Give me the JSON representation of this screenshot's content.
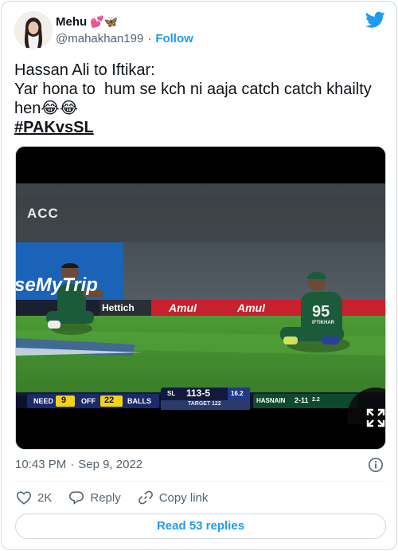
{
  "user": {
    "display_name": "Mehu",
    "name_emoji": "💕🦋",
    "handle": "@mahakhan199",
    "separator": "·",
    "follow_label": "Follow"
  },
  "tweet": {
    "text_lines": [
      "Hassan Ali to Iftikar:",
      "Yar hona to  hum se kch ni aaja catch catch khailty",
      "hen😂😂"
    ],
    "hashtag": "#PAKvsSL",
    "time": "10:43 PM",
    "date_separator": "·",
    "date": "Sep 9, 2022"
  },
  "media": {
    "broadcaster_logo": "ACC",
    "ad_boards": [
      "Amul",
      "Amul",
      "Hettich",
      "seMyTrip"
    ],
    "player_shirt": "95",
    "player_name": "IFTIKHAR",
    "scorebar": {
      "need_label": "NEED",
      "need_value": "9",
      "off_label": "OFF",
      "off_value": "22",
      "balls_label": "BALLS",
      "team": "SL",
      "score": "113-5",
      "overs": "16.2",
      "target_label": "TARGET",
      "target_value": "122",
      "bowler": "HASNAIN",
      "bowler_figures": "2-11",
      "bowler_overs": "2.2"
    },
    "colors": {
      "pitch_green": "#3f8a2e",
      "board_red": "#c8202c",
      "scorebar_navy": "#1c2a6b"
    }
  },
  "actions": {
    "like_count": "2K",
    "reply_label": "Reply",
    "copy_label": "Copy link"
  },
  "read_replies_label": "Read 53 replies",
  "icons": {
    "brand": "twitter-bird-icon",
    "info": "info-icon",
    "like": "heart-icon",
    "reply": "speech-bubble-icon",
    "copy": "link-icon",
    "expand": "expand-icon"
  },
  "colors": {
    "accent": "#1d9bf0",
    "secondary_text": "#536471",
    "like_red": "#f91880"
  }
}
